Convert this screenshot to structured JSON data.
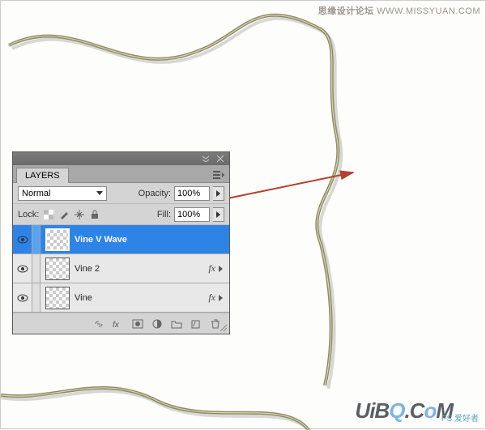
{
  "watermarks": {
    "top_cn": "思缘设计论坛",
    "top_url": "WWW.MISSYUAN.COM",
    "bottom_logo": "UiBQ.CoM",
    "bottom_ps": "PS 爱好者"
  },
  "panel": {
    "tabs": [
      {
        "label": "LAYERS",
        "active": true
      }
    ],
    "blend_mode": "Normal",
    "opacity_label": "Opacity:",
    "opacity_value": "100%",
    "lock_label": "Lock:",
    "fill_label": "Fill:",
    "fill_value": "100%",
    "layers": [
      {
        "name": "Vine V Wave",
        "visible": true,
        "selected": true,
        "has_fx": false
      },
      {
        "name": "Vine 2",
        "visible": true,
        "selected": false,
        "has_fx": true
      },
      {
        "name": "Vine",
        "visible": true,
        "selected": false,
        "has_fx": true
      }
    ],
    "fx_label": "fx"
  }
}
